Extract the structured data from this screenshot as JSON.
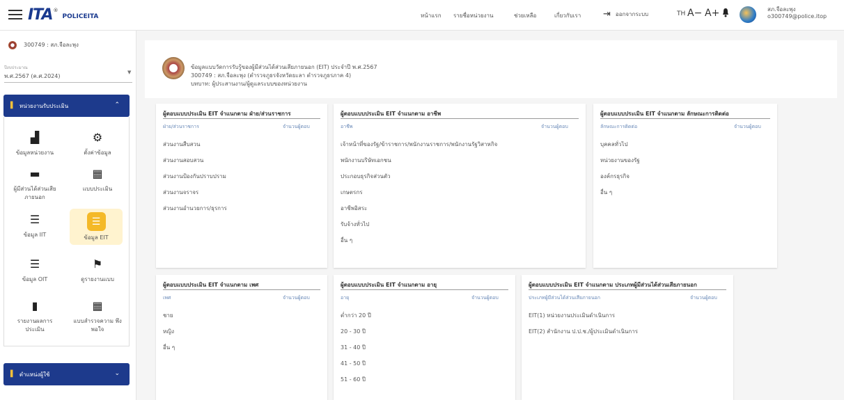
{
  "topbar": {
    "logo_mark": "ITA",
    "logo_reg": "®",
    "logo_text": "POLICEITA",
    "nav": [
      "หน้าแรก",
      "รายชื่อหน่วยงาน",
      "ช่วยเหลือ",
      "เกี่ยวกับเรา"
    ],
    "logout_label": "ออกจากระบบ",
    "lang": "TH",
    "font_minus": "A−",
    "font_plus": "A+",
    "user_name": "สภ.จือละพุง",
    "user_email": "o300749@police.itop"
  },
  "sidebar": {
    "user": "300749 : สภ.จือละพุง",
    "year_label": "ปีงบประมาณ",
    "year_value": "พ.ศ.2567 (ค.ศ.2024)",
    "section_assess": "หน่วยงานรับประเมิน",
    "section_audit": "ตำแหน่งผู้ใช้",
    "tiles": [
      {
        "icon": "building-icon",
        "glyph": "▟",
        "label": "ข้อมูลหน่วยงาน"
      },
      {
        "icon": "settings-icon",
        "glyph": "⚙",
        "label": "ตั้งค่าข้อมูล"
      },
      {
        "icon": "store-icon",
        "glyph": "▬",
        "label": "ผู้มีส่วนได้ส่วนเสีย ภายนอก"
      },
      {
        "icon": "qr-icon",
        "glyph": "▦",
        "label": "แบบประเมิน"
      },
      {
        "icon": "checklist-icon",
        "glyph": "☰",
        "label": "ข้อมูล IIT"
      },
      {
        "icon": "checklist-icon",
        "glyph": "☰",
        "label": "ข้อมูล EIT"
      },
      {
        "icon": "checklist-icon",
        "glyph": "☰",
        "label": "ข้อมูล OIT"
      },
      {
        "icon": "flag-icon",
        "glyph": "⚑",
        "label": "ดูรายงานแบบ"
      },
      {
        "icon": "bar-chart-icon",
        "glyph": "▮",
        "label": "รายงานผลการ ประเมิน"
      },
      {
        "icon": "qr-icon",
        "glyph": "▦",
        "label": "แบบสำรวจความ พึงพอใจ"
      }
    ]
  },
  "header": {
    "line1": "ข้อมูลแบบวัดการรับรู้ของผู้มีส่วนได้ส่วนเสียภายนอก (EIT) ประจำปี พ.ศ.2567",
    "line2": "300749 : สภ.จือละพุง (ตำรวจภูธรจังหวัดยะลา ตำรวจภูธรภาค 4)",
    "line3": "บทบาท: ผู้ประสานงาน/ผู้ดูแลระบบของหน่วยงาน"
  },
  "cards": {
    "by_division": {
      "title": "ผู้ตอบแบบประเมิน EIT จำแนกตาม ฝ่าย/ส่วนราชการ",
      "col1": "ฝ่าย/ส่วนราชการ",
      "col2": "จำนวนผู้ตอบ",
      "rows": [
        "ส่วนงานสืบสวน",
        "ส่วนงานสอบสวน",
        "ส่วนงานป้องกันปราบปราม",
        "ส่วนงานจราจร",
        "ส่วนงานอำนวยการ/ธุรการ"
      ]
    },
    "by_occupation": {
      "title": "ผู้ตอบแบบประเมิน EIT จำแนกตาม อาชีพ",
      "col1": "อาชีพ",
      "col2": "จำนวนผู้ตอบ",
      "rows": [
        "เจ้าหน้าที่ของรัฐ/ข้าราชการ/พนักงานราชการ/พนักงานรัฐวิสาหกิจ",
        "พนักงานบริษัทเอกชน",
        "ประกอบธุรกิจส่วนตัว",
        "เกษตรกร",
        "อาชีพอิสระ",
        "รับจ้างทั่วไป",
        "อื่น ๆ"
      ]
    },
    "by_contact": {
      "title": "ผู้ตอบแบบประเมิน EIT จำแนกตาม ลักษณะการติดต่อ",
      "col1": "ลักษณะการติดต่อ",
      "col2": "จำนวนผู้ตอบ",
      "rows": [
        "บุคคลทั่วไป",
        "หน่วยงานของรัฐ",
        "องค์กรธุรกิจ",
        "อื่น ๆ"
      ]
    },
    "by_gender": {
      "title": "ผู้ตอบแบบประเมิน EIT จำแนกตาม เพศ",
      "col1": "เพศ",
      "col2": "จำนวนผู้ตอบ",
      "rows": [
        "ชาย",
        "หญิง",
        "อื่น ๆ"
      ]
    },
    "by_age": {
      "title": "ผู้ตอบแบบประเมิน EIT จำแนกตาม อายุ",
      "col1": "อายุ",
      "col2": "จำนวนผู้ตอบ",
      "rows": [
        "ต่ำกว่า 20 ปี",
        "20 - 30 ปี",
        "31 - 40 ปี",
        "41 - 50 ปี",
        "51 - 60 ปี"
      ]
    },
    "by_stakeholder": {
      "title": "ผู้ตอบแบบประเมิน EIT จำแนกตาม ประเภทผู้มีส่วนได้ส่วนเสียภายนอก",
      "col1": "ประเภทผู้มีส่วนได้ส่วนเสียภายนอก",
      "col2": "จำนวนผู้ตอบ",
      "rows": [
        "EIT(1) หน่วยงานประเมินดำเนินการ",
        "EIT(2) สำนักงาน ป.ป.ช./ผู้ประเมินดำเนินการ"
      ]
    }
  }
}
